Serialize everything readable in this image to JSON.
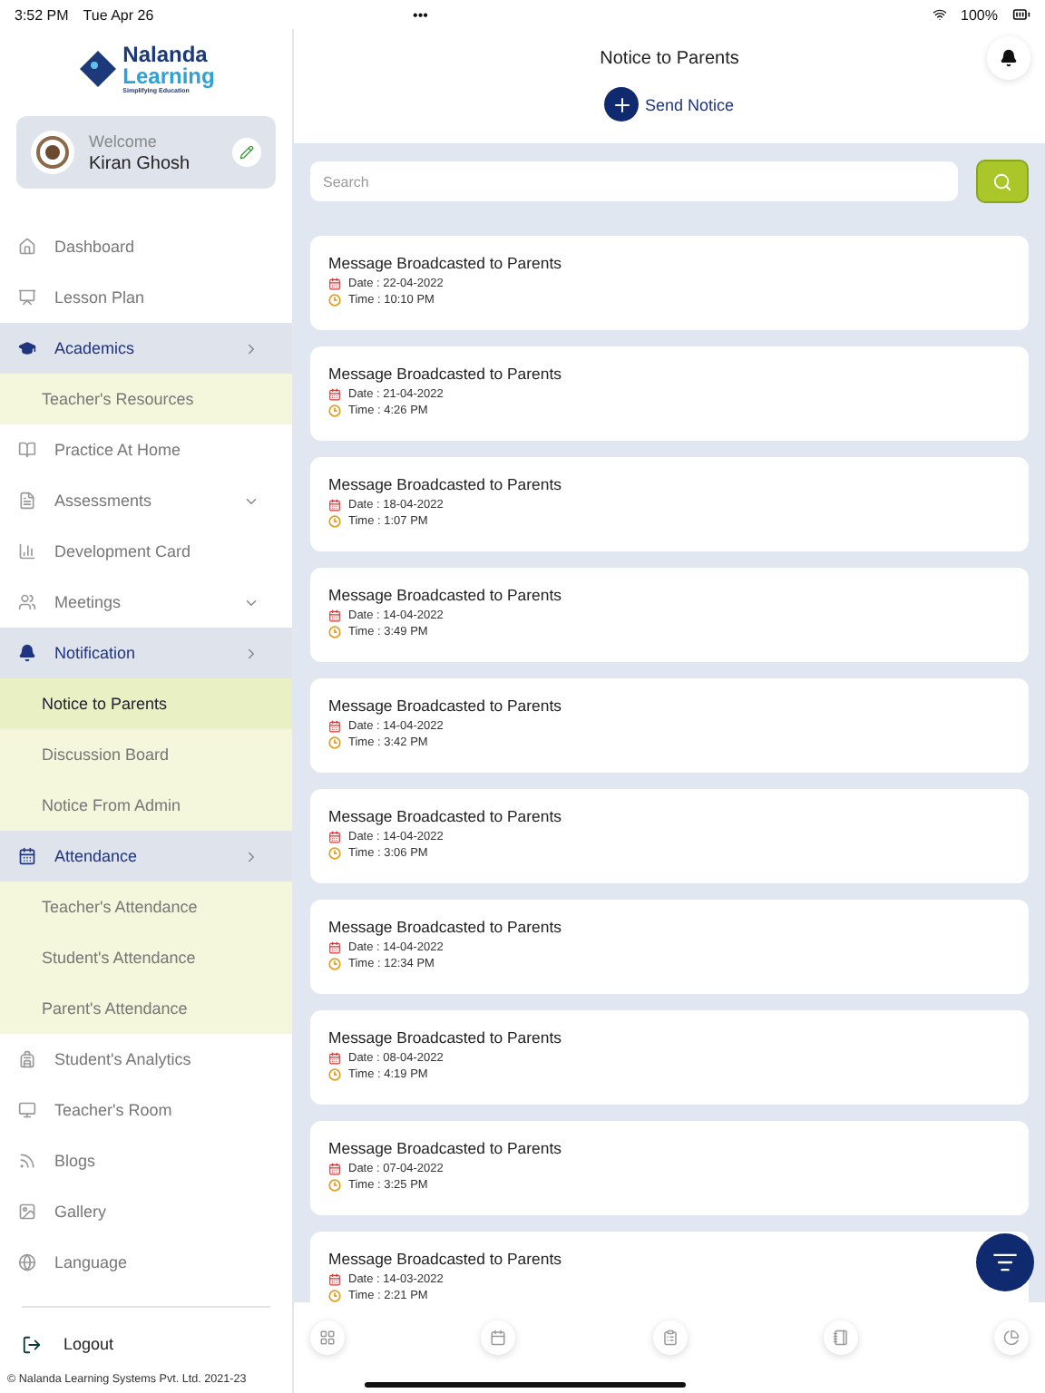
{
  "status_bar": {
    "time": "3:52 PM",
    "date": "Tue Apr 26",
    "dots": "•••",
    "battery": "100%"
  },
  "brand": {
    "name": "Nalanda",
    "name2": "Learning",
    "tagline": "Simplifying Education"
  },
  "profile": {
    "greeting": "Welcome",
    "name": "Kiran Ghosh"
  },
  "sidebar": {
    "items": [
      {
        "kind": "item",
        "label": "Dashboard",
        "expanded": false
      },
      {
        "kind": "item",
        "label": "Lesson Plan",
        "expanded": false
      },
      {
        "kind": "item",
        "label": "Academics",
        "expanded": true,
        "chevron_down": false
      },
      {
        "kind": "sub",
        "label": "Teacher's Resources",
        "selected": false
      },
      {
        "kind": "item",
        "label": "Practice At Home",
        "expanded": false
      },
      {
        "kind": "item",
        "label": "Assessments",
        "expanded": false,
        "chevron_down": true
      },
      {
        "kind": "item",
        "label": "Development Card",
        "expanded": false
      },
      {
        "kind": "item",
        "label": "Meetings",
        "expanded": false,
        "chevron_down": true
      },
      {
        "kind": "item",
        "label": "Notification",
        "expanded": true,
        "chevron_down": false
      },
      {
        "kind": "sub",
        "label": "Notice to Parents",
        "selected": true
      },
      {
        "kind": "sub",
        "label": "Discussion Board",
        "selected": false
      },
      {
        "kind": "sub",
        "label": "Notice From Admin",
        "selected": false
      },
      {
        "kind": "item",
        "label": "Attendance",
        "expanded": true,
        "chevron_down": false
      },
      {
        "kind": "sub",
        "label": "Teacher's Attendance",
        "selected": false
      },
      {
        "kind": "sub",
        "label": "Student's Attendance",
        "selected": false
      },
      {
        "kind": "sub",
        "label": "Parent's Attendance",
        "selected": false
      },
      {
        "kind": "item",
        "label": "Student's Analytics",
        "expanded": false
      },
      {
        "kind": "item",
        "label": "Teacher's Room",
        "expanded": false
      },
      {
        "kind": "item",
        "label": "Blogs",
        "expanded": false
      },
      {
        "kind": "item",
        "label": "Gallery",
        "expanded": false
      },
      {
        "kind": "item",
        "label": "Language",
        "expanded": false
      }
    ],
    "logout": "Logout",
    "footer": "© Nalanda Learning Systems Pvt. Ltd. 2021-23"
  },
  "header": {
    "title": "Notice to Parents",
    "action": "Send Notice"
  },
  "search": {
    "placeholder": "Search"
  },
  "notices": [
    {
      "title": "Message Broadcasted to Parents",
      "date": "Date : 22-04-2022",
      "time": "Time : 10:10 PM"
    },
    {
      "title": "Message Broadcasted to Parents",
      "date": "Date : 21-04-2022",
      "time": "Time : 4:26 PM"
    },
    {
      "title": "Message Broadcasted to Parents",
      "date": "Date : 18-04-2022",
      "time": "Time : 1:07 PM"
    },
    {
      "title": "Message Broadcasted to Parents",
      "date": "Date : 14-04-2022",
      "time": "Time : 3:49 PM"
    },
    {
      "title": "Message Broadcasted to Parents",
      "date": "Date : 14-04-2022",
      "time": "Time : 3:42 PM"
    },
    {
      "title": "Message Broadcasted to Parents",
      "date": "Date : 14-04-2022",
      "time": "Time : 3:06 PM"
    },
    {
      "title": "Message Broadcasted to Parents",
      "date": "Date : 14-04-2022",
      "time": "Time : 12:34 PM"
    },
    {
      "title": "Message Broadcasted to Parents",
      "date": "Date : 08-04-2022",
      "time": "Time : 4:19 PM"
    },
    {
      "title": "Message Broadcasted to Parents",
      "date": "Date : 07-04-2022",
      "time": "Time : 3:25 PM"
    },
    {
      "title": "Message Broadcasted to Parents",
      "date": "Date : 14-03-2022",
      "time": "Time : 2:21 PM"
    }
  ]
}
